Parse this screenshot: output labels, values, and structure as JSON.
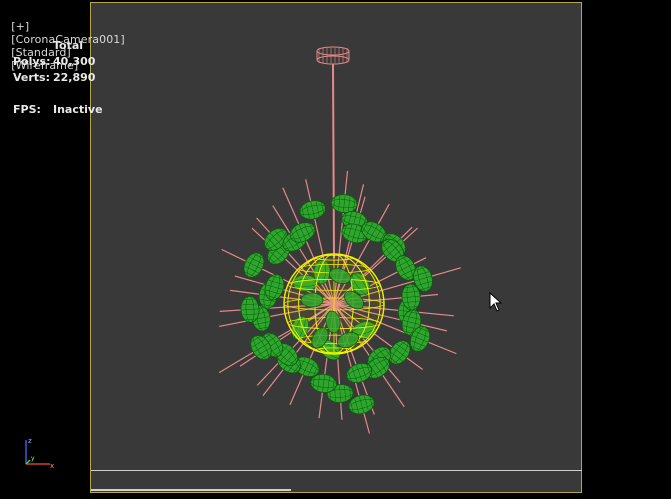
{
  "viewport": {
    "plus_label": "[+]",
    "camera_label": "[CoronaCamera001]",
    "shading_label": "[Standard]",
    "display_label": "[Wireframe]"
  },
  "stats": {
    "header": "Total",
    "polys_label": "Polys:",
    "polys_value": "40,300",
    "verts_label": "Verts:",
    "verts_value": "22,890",
    "fps_label": "FPS:",
    "fps_value": "Inactive"
  },
  "axis": {
    "z": "z",
    "x": "x",
    "y": "y"
  },
  "colors": {
    "background": "#393939",
    "border": "#b9a84a",
    "wire_pink": "#e48a8a",
    "wire_green": "#2ea62e",
    "wire_yellow": "#f2f200"
  }
}
